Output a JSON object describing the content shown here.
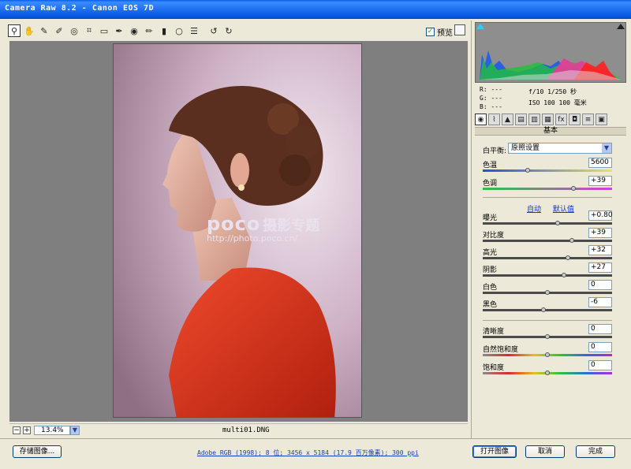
{
  "window": {
    "title": "Camera Raw 8.2 -  Canon EOS 7D"
  },
  "toolbar": {
    "tools": [
      {
        "name": "zoom-icon",
        "glyph": "⚲"
      },
      {
        "name": "hand-icon",
        "glyph": "✋"
      },
      {
        "name": "white-balance-icon",
        "glyph": "✎"
      },
      {
        "name": "color-sampler-icon",
        "glyph": "✐"
      },
      {
        "name": "target-adjust-icon",
        "glyph": "◎"
      },
      {
        "name": "crop-icon",
        "glyph": "⌗"
      },
      {
        "name": "straighten-icon",
        "glyph": "▭"
      },
      {
        "name": "spot-removal-icon",
        "glyph": "✒"
      },
      {
        "name": "red-eye-icon",
        "glyph": "◉"
      },
      {
        "name": "adjustment-brush-icon",
        "glyph": "✏"
      },
      {
        "name": "graduated-filter-icon",
        "glyph": "▮"
      },
      {
        "name": "radial-filter-icon",
        "glyph": "○"
      },
      {
        "name": "preferences-icon",
        "glyph": "☰"
      },
      {
        "name": "rotate-ccw-icon",
        "glyph": "↺"
      },
      {
        "name": "rotate-cw-icon",
        "glyph": "↻"
      }
    ],
    "preview_label": "预览",
    "preview_checked": "✓"
  },
  "status": {
    "zoom": "13.4%",
    "filename": "multi01.DNG"
  },
  "watermark": {
    "brand": "poco",
    "tagline": "摄影专题",
    "url": "http://photo.poco.cn/"
  },
  "readout": {
    "r": "R:  ---",
    "g": "G:  ---",
    "b": "B:  ---",
    "exif_line1": "f/10   1/250 秒",
    "exif_line2": "ISO 100   100 毫米"
  },
  "panel": {
    "tabs": [
      "◉",
      "⌇",
      "▲",
      "▤",
      "▥",
      "▦",
      "fx",
      "◘",
      "≡",
      "▣"
    ],
    "header": "基本",
    "white_balance_label": "白平衡:",
    "white_balance_value": "原照设置",
    "auto_link": "自动",
    "default_link": "默认值"
  },
  "controls": [
    {
      "id": "temperature",
      "label": "色温",
      "value": "5600",
      "pos": 0.35,
      "track": "temp"
    },
    {
      "id": "tint",
      "label": "色调",
      "value": "+39",
      "pos": 0.7,
      "track": "tint"
    },
    {
      "id": "exposure",
      "label": "曝光",
      "value": "+0.80",
      "pos": 0.58,
      "track": "plain"
    },
    {
      "id": "contrast",
      "label": "对比度",
      "value": "+39",
      "pos": 0.69,
      "track": "plain"
    },
    {
      "id": "highlights",
      "label": "高光",
      "value": "+32",
      "pos": 0.66,
      "track": "plain"
    },
    {
      "id": "shadows",
      "label": "阴影",
      "value": "+27",
      "pos": 0.63,
      "track": "plain"
    },
    {
      "id": "whites",
      "label": "白色",
      "value": "0",
      "pos": 0.5,
      "track": "plain"
    },
    {
      "id": "blacks",
      "label": "黑色",
      "value": "-6",
      "pos": 0.47,
      "track": "plain"
    },
    {
      "id": "clarity",
      "label": "清晰度",
      "value": "0",
      "pos": 0.5,
      "track": "plain"
    },
    {
      "id": "vibrance",
      "label": "自然饱和度",
      "value": "0",
      "pos": 0.5,
      "track": "rainbow"
    },
    {
      "id": "saturation",
      "label": "饱和度",
      "value": "0",
      "pos": 0.5,
      "track": "rainbow"
    }
  ],
  "bottom": {
    "save_button": "存储图像...",
    "workflow_options": "Adobe RGB (1998); 8 位; 3456 x 5184 (17.9 百万像素); 300 ppi",
    "open_button": "打开图像",
    "cancel_button": "取消",
    "done_button": "完成"
  },
  "colors": {
    "title_bar": "#1f6ff0",
    "background": "#7f7f7f",
    "sweater": "#d8301e",
    "backdrop": "#d9c4d4"
  }
}
